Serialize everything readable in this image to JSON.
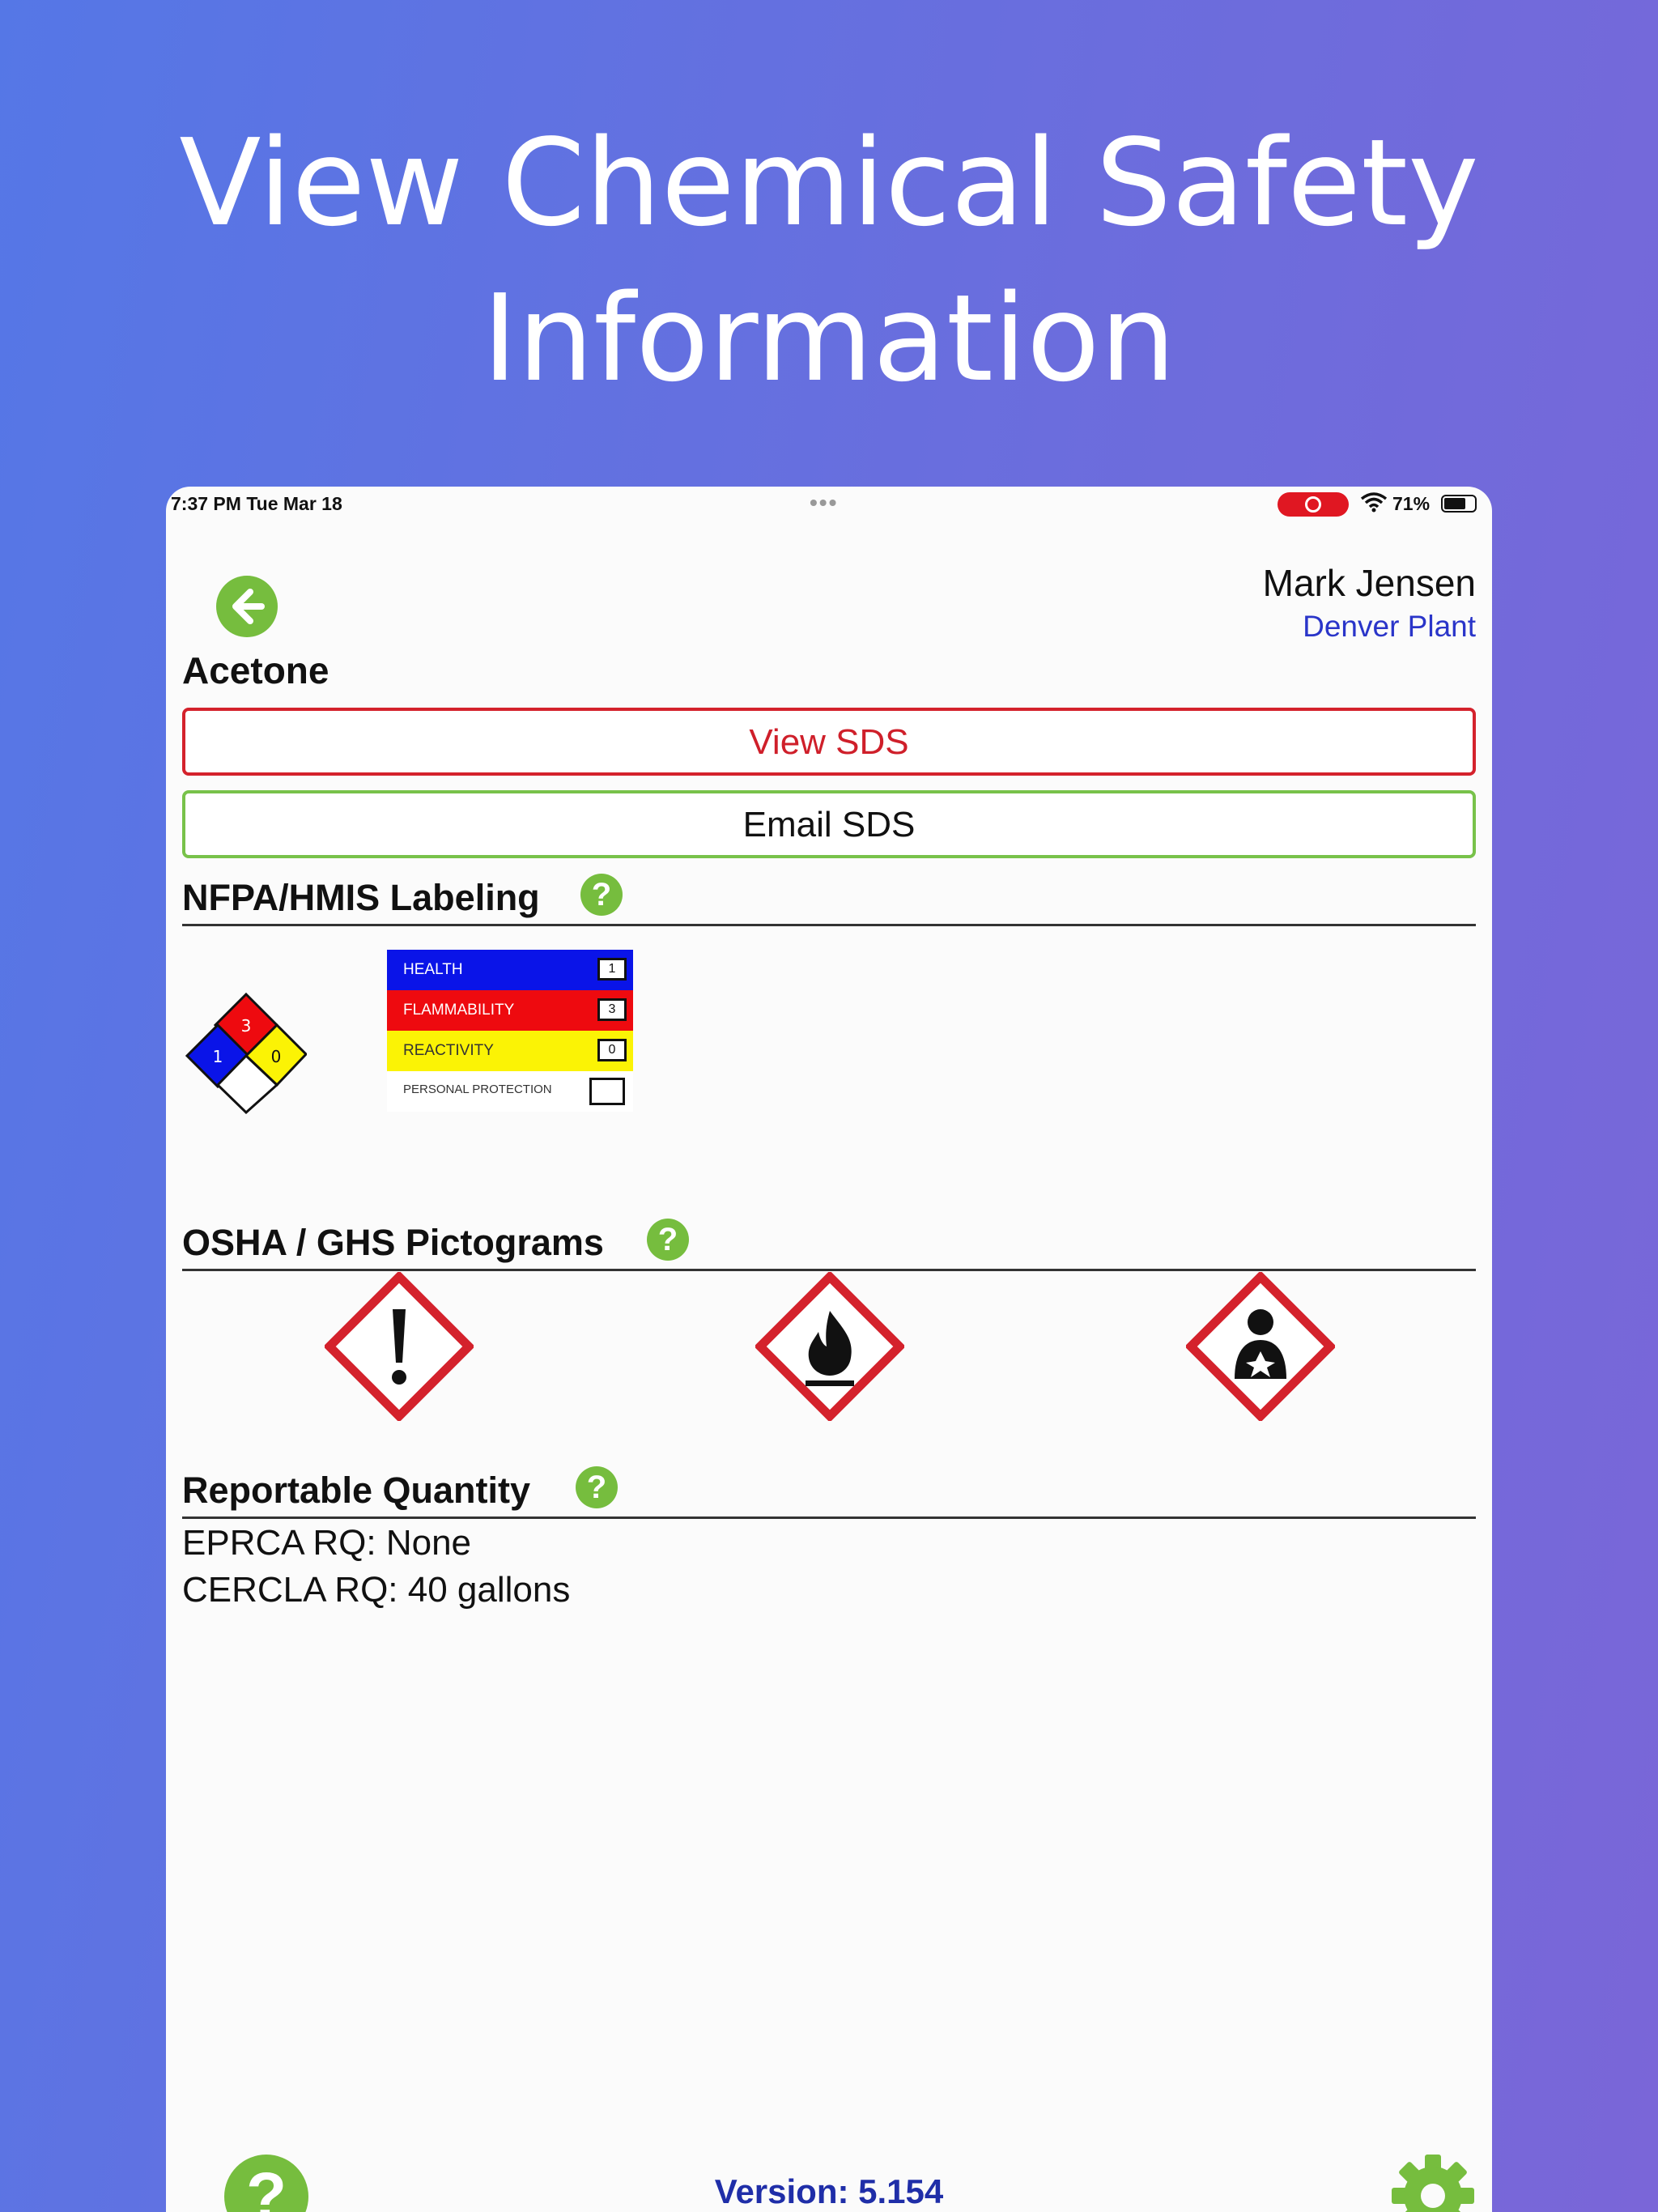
{
  "headline": {
    "line1": "View Chemical Safety",
    "line2": "Information"
  },
  "status_bar": {
    "time": "7:37 PM   Tue Mar 18",
    "dots": "•••",
    "battery": "71%"
  },
  "header": {
    "back_icon": "arrow-left-icon",
    "user_name": "Mark Jensen",
    "site": "Denver Plant",
    "chemical": "Acetone"
  },
  "actions": {
    "view_sds": "View SDS",
    "email_sds": "Email SDS"
  },
  "nfpa_hmis": {
    "title": "NFPA/HMIS Labeling",
    "nfpa": {
      "health": "1",
      "flammability": "3",
      "reactivity": "0",
      "special": ""
    },
    "hmis": [
      {
        "label": "HEALTH",
        "value": "1",
        "color": "#0a14e8"
      },
      {
        "label": "FLAMMABILITY",
        "value": "3",
        "color": "#ee0a0f"
      },
      {
        "label": "REACTIVITY",
        "value": "0",
        "color": "#fbf305"
      },
      {
        "label": "PERSONAL PROTECTION",
        "value": "",
        "color": "#ffffff"
      }
    ]
  },
  "ghs": {
    "title": "OSHA / GHS Pictograms",
    "pictograms": [
      "exclamation-mark-icon",
      "flame-icon",
      "health-hazard-icon"
    ],
    "border_color": "#d4222c"
  },
  "reportable_quantity": {
    "title": "Reportable Quantity",
    "eprca": "EPRCA RQ: None",
    "cercla": "CERCLA RQ: 40 gallons"
  },
  "footer": {
    "help": "?",
    "version": "Version: 5.154",
    "settings_icon": "gear-icon"
  },
  "colors": {
    "accent_green": "#76bd3e",
    "alert_red": "#d4222c",
    "link_blue": "#2a35c9"
  }
}
